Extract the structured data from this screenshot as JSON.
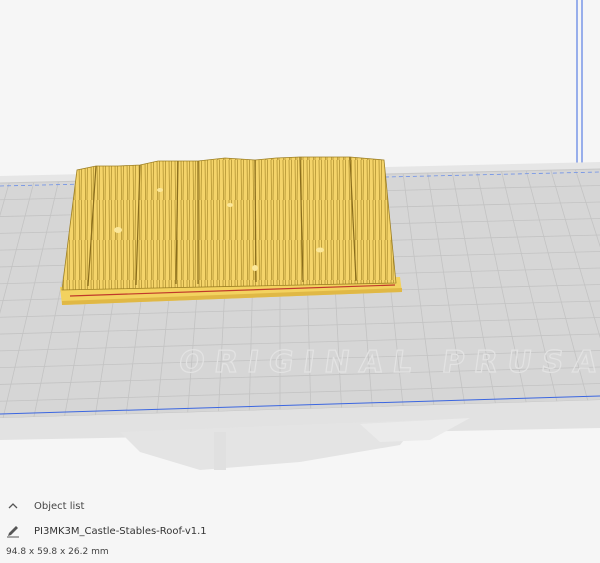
{
  "scene": {
    "bed_watermark": "ORIGINAL PRUSA",
    "model_color": "#f6d364",
    "model_shadow": "#c9a83a",
    "bed_color": "#d6d6d6",
    "grid_color": "#bdbdbd",
    "axis_blue": "#3b66e0"
  },
  "object_list": {
    "toggle_icon": "chevron-up-icon",
    "label": "Object list",
    "edit_icon": "pencil-icon",
    "object_name": "PI3MK3M_Castle-Stables-Roof-v1.1",
    "dimensions": "94.8 x 59.8 x 26.2 mm"
  }
}
